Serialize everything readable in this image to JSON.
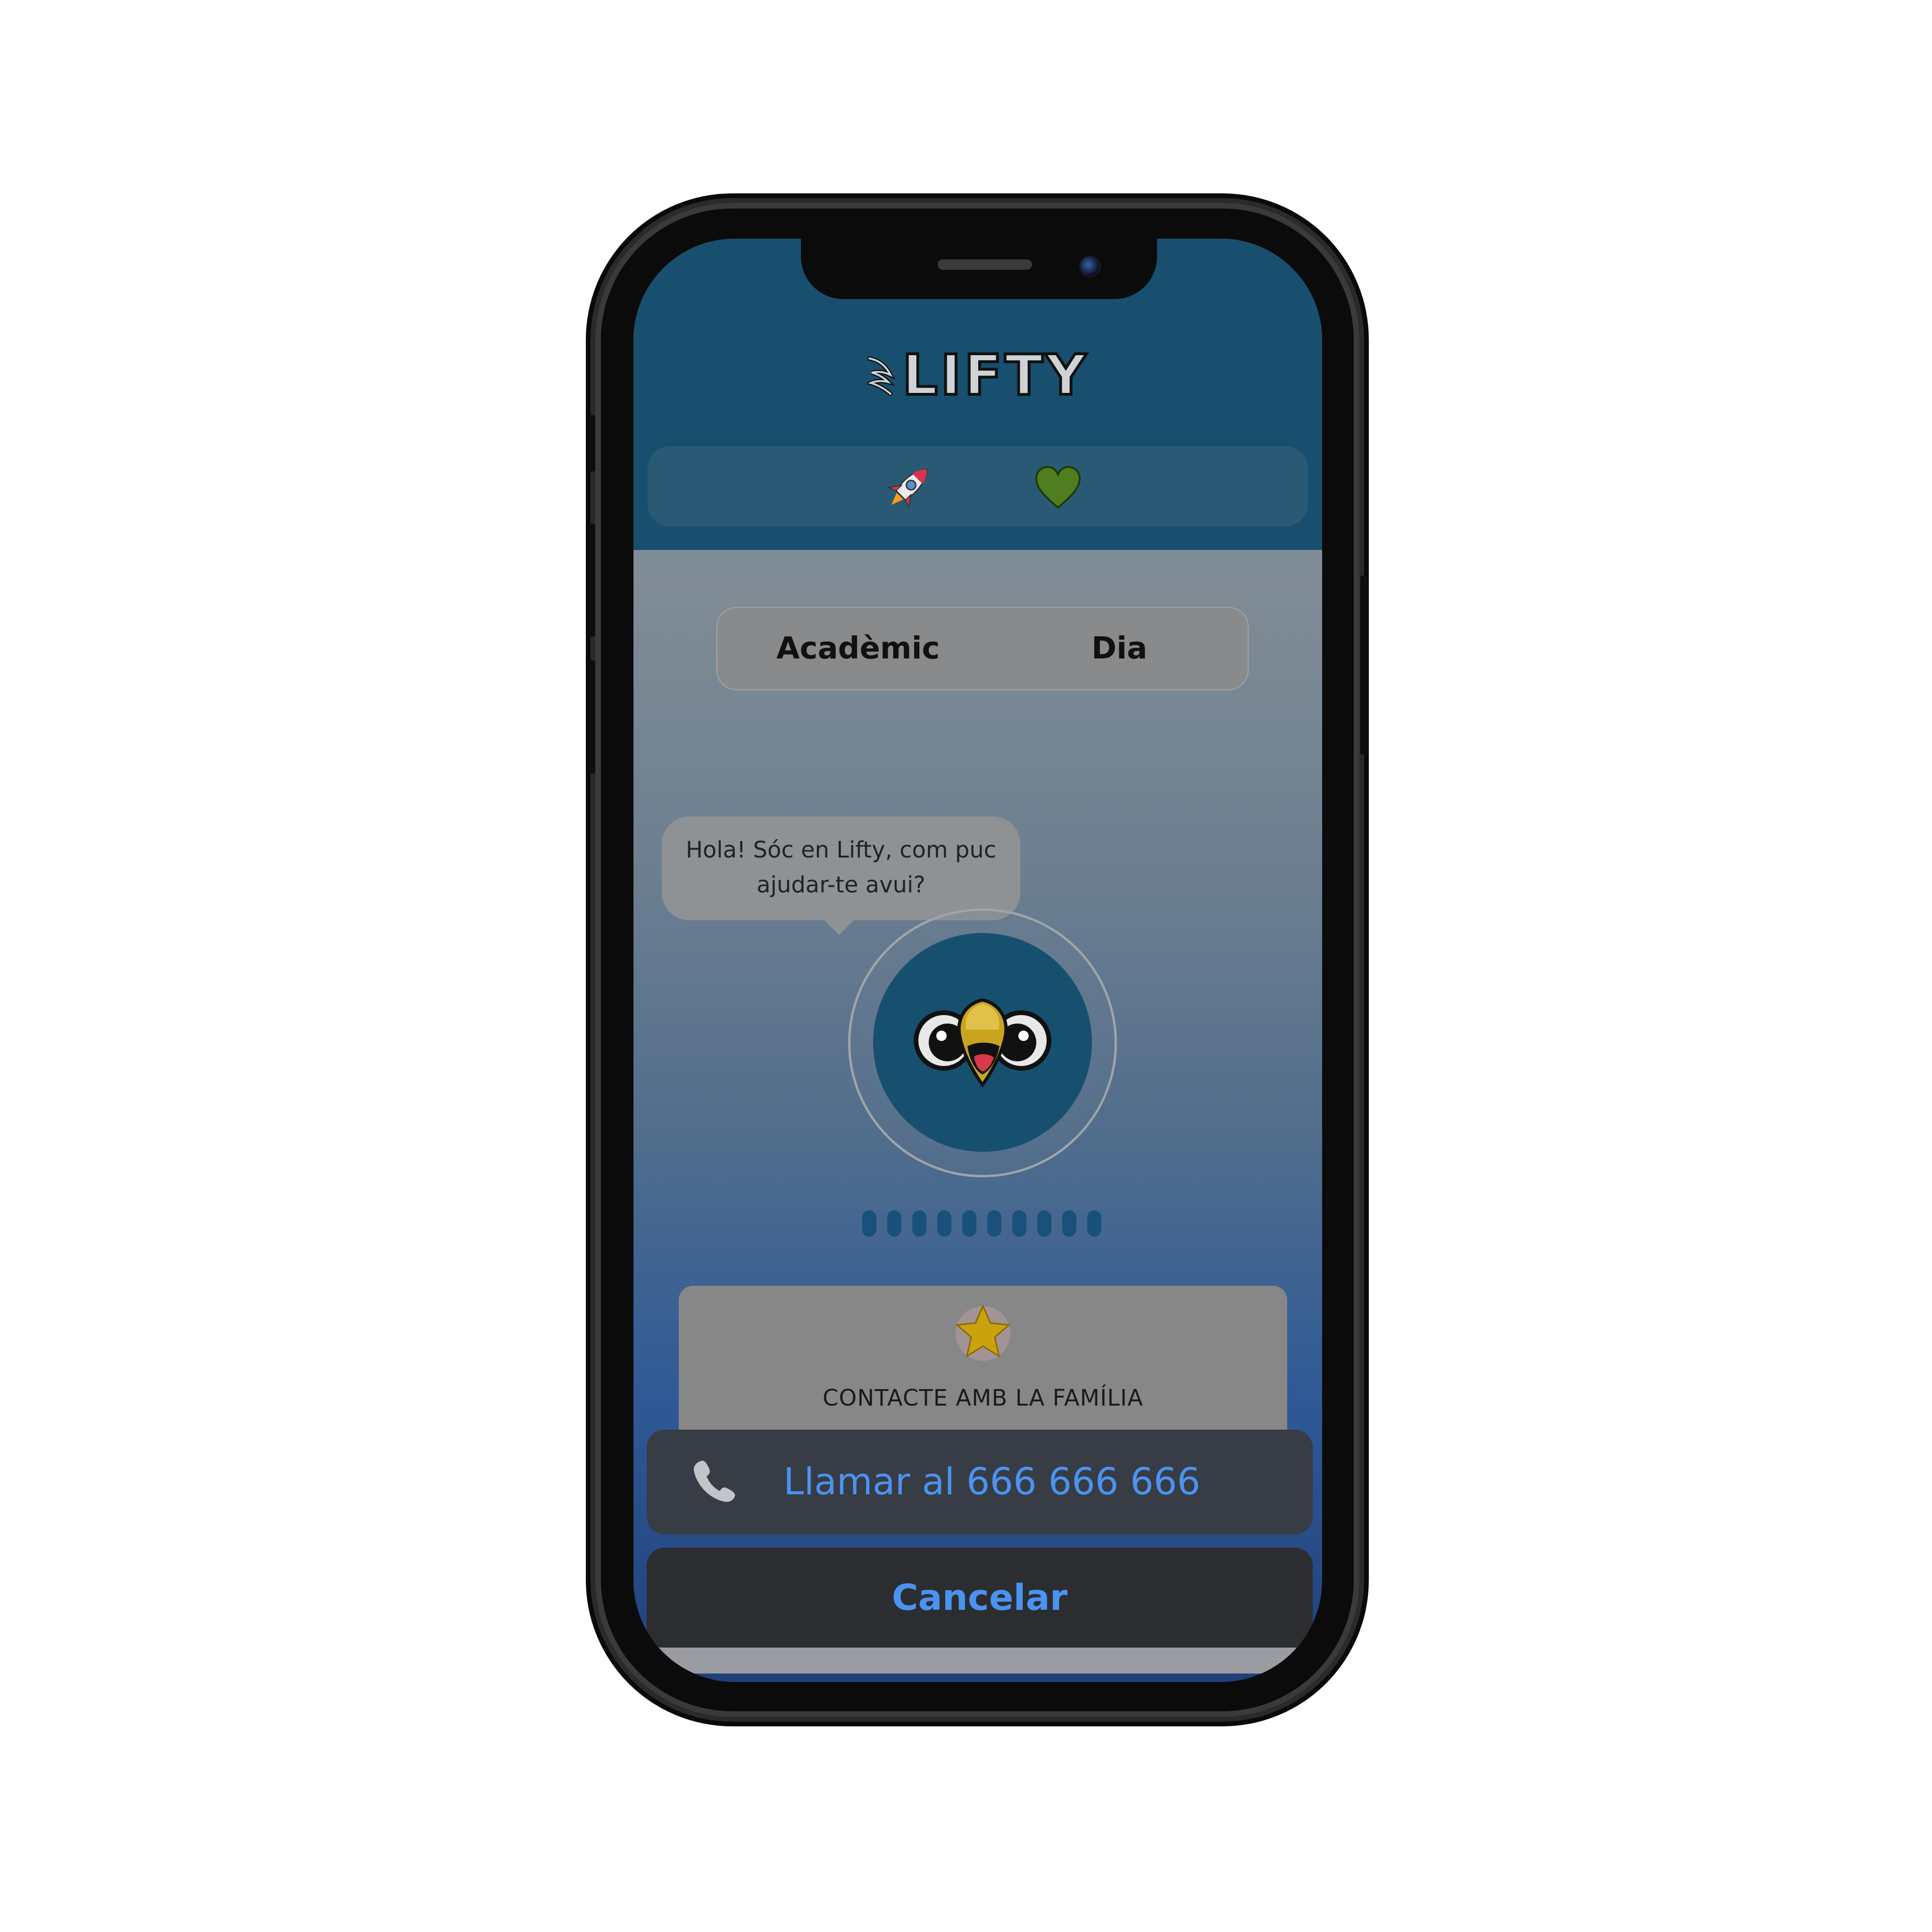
{
  "app": {
    "name": "LIFTY"
  },
  "status_icons": {
    "left": "rocket-icon",
    "right": "heart-icon",
    "heart_color": "#4f7d1f"
  },
  "tabs": [
    {
      "label": "Acadèmic"
    },
    {
      "label": "Dia"
    }
  ],
  "chat": {
    "line1": "Hola! Sóc en Lifty, com puc",
    "line2": "ajudar-te avui?"
  },
  "contact": {
    "icon": "star-icon",
    "label": "CONTACTE AMB LA FAMÍLIA"
  },
  "action_sheet": {
    "call_label": "Llamar al 666 666 666",
    "cancel_label": "Cancelar",
    "accent": "#4a93f0"
  },
  "colors": {
    "header": "#184f6e",
    "avatar_bg": "#17506f"
  }
}
